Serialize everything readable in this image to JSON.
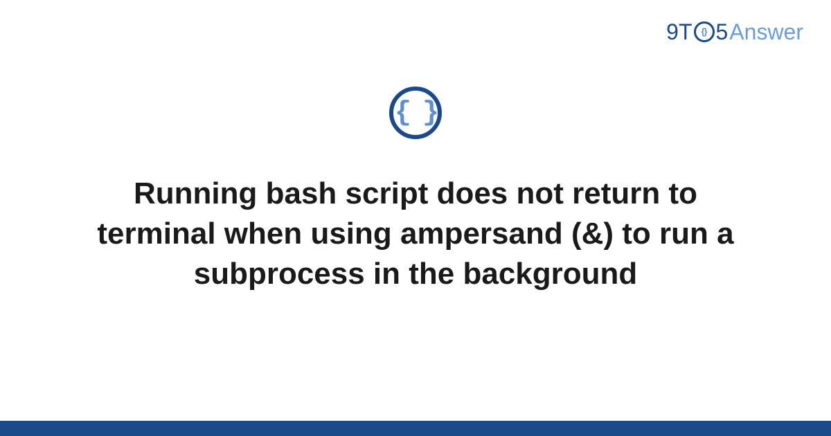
{
  "logo": {
    "part1": "9T",
    "circle_content": "{}",
    "part2": "5",
    "part3": "Answer"
  },
  "icon": {
    "braces": "{ }"
  },
  "title": "Running bash script does not return to terminal when using ampersand (&) to run a subprocess in the background",
  "colors": {
    "brand_dark": "#1a4a8a",
    "brand_light": "#6a9edb",
    "text": "#1a1a1a"
  }
}
